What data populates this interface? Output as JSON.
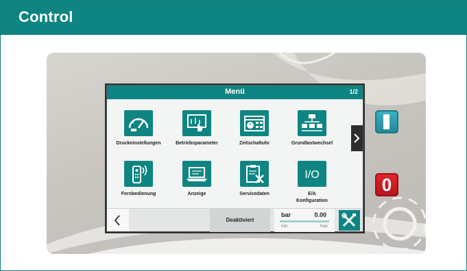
{
  "banner": {
    "title": "Control"
  },
  "screen": {
    "title": "Menü",
    "page_indicator": "1/2",
    "tiles": [
      {
        "label": "Druckeinstellungen",
        "icon": "gauge-icon"
      },
      {
        "label": "Betriebsparameter",
        "icon": "touch-panel-icon"
      },
      {
        "label": "Zeitschaltuhr",
        "icon": "calendar-clock-icon"
      },
      {
        "label": "Grundlastwechsel",
        "icon": "hierarchy-icon"
      },
      {
        "label": "Fernbedienung",
        "icon": "remote-control-icon"
      },
      {
        "label": "Anzeige",
        "icon": "laptop-display-icon"
      },
      {
        "label": "Servicedaten",
        "icon": "clipboard-tools-icon"
      },
      {
        "label": "E/A\nKonfiguration",
        "icon": "io-icon",
        "icon_text": "I/O"
      }
    ],
    "footer": {
      "status": "Deaktiviert",
      "unit": "bar",
      "value": "0.00",
      "range_min": "min",
      "range_max": "max",
      "pressure_fraction": 0.0
    }
  },
  "hardware": {
    "on_label": "I",
    "off_label": "0"
  },
  "colors": {
    "brand_teal": "#0e8582",
    "on_button": "#2aa0b3",
    "off_button": "#d81f25"
  }
}
